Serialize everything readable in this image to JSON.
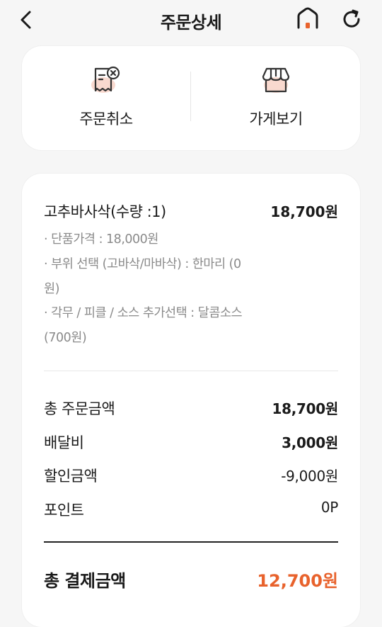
{
  "header": {
    "title": "주문상세",
    "back_icon": "chevron-left-icon",
    "home_icon": "home-icon",
    "refresh_icon": "refresh-icon"
  },
  "actions": {
    "cancel_label": "주문취소",
    "store_label": "가게보기"
  },
  "order": {
    "item_name": "고추바사삭(수량 :1)",
    "item_price": "18,700원",
    "options": [
      "· 단품가격 : 18,000원",
      "· 부위 선택 (고바삭/마바삭) : 한마리 (0원)",
      "· 각무 / 피클 / 소스 추가선택 : 달콤소스 (700원)"
    ]
  },
  "summary": {
    "order_total_label": "총 주문금액",
    "order_total_value": "18,700원",
    "delivery_label": "배달비",
    "delivery_value": "3,000원",
    "discount_label": "할인금액",
    "discount_value": "-9,000원",
    "point_label": "포인트",
    "point_value": "0P"
  },
  "payment": {
    "label": "총 결제금액",
    "value": "12,700원"
  },
  "colors": {
    "accent": "#e8622c",
    "icon_bg": "#f9d9cf"
  }
}
